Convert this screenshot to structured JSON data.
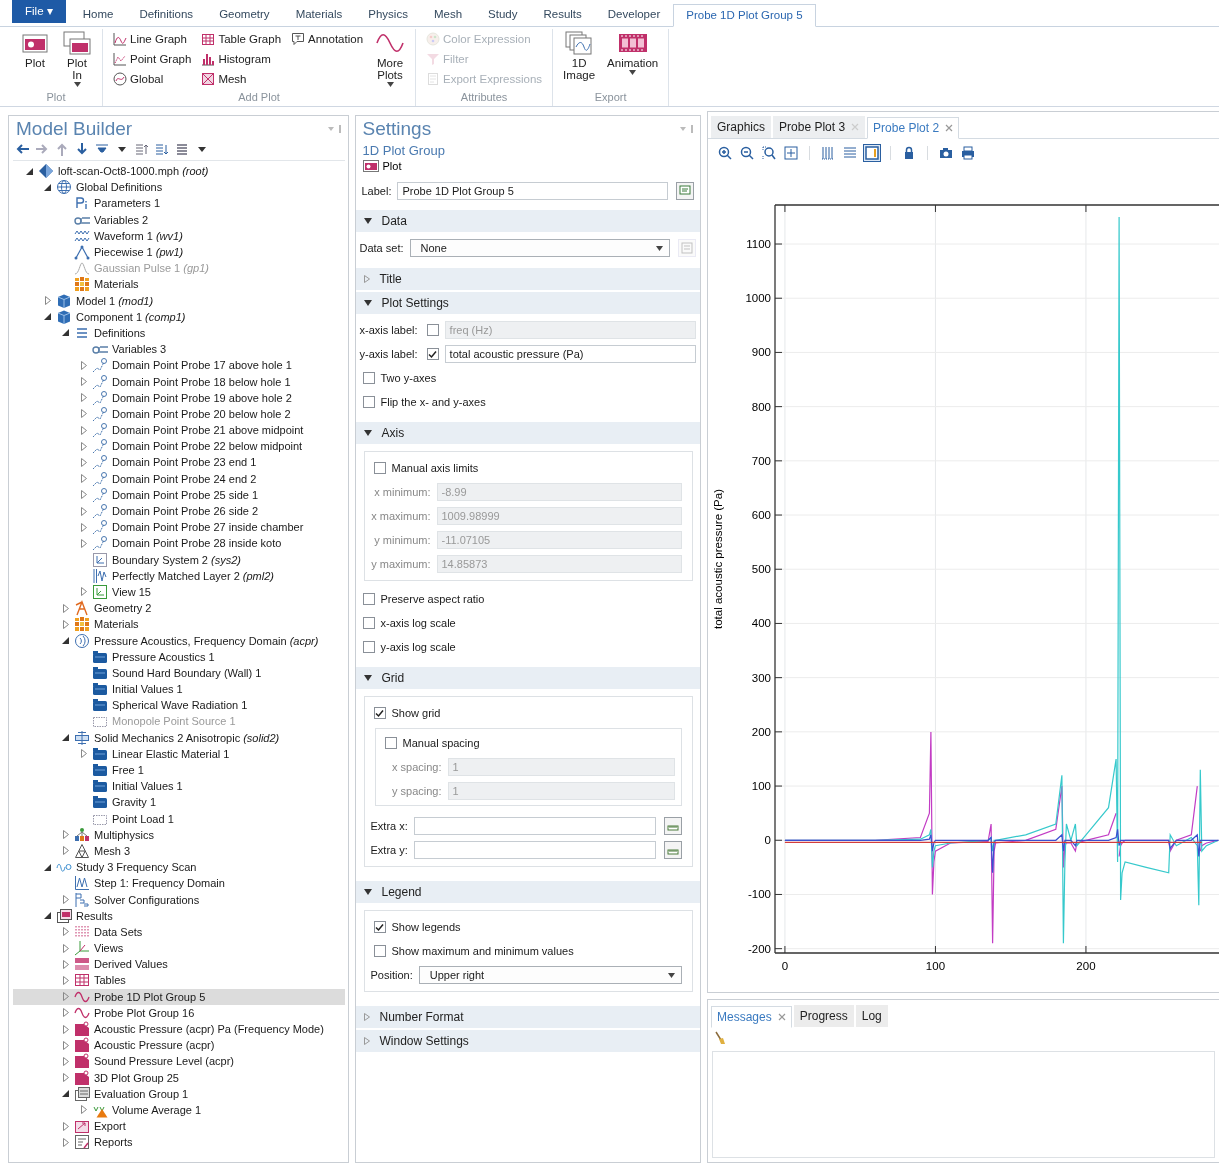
{
  "ribbon": {
    "tabs": [
      {
        "label": "File ▾",
        "kind": "file",
        "selected": false
      },
      {
        "label": "Home",
        "kind": "tab",
        "selected": false
      },
      {
        "label": "Definitions",
        "kind": "tab",
        "selected": false
      },
      {
        "label": "Geometry",
        "kind": "tab",
        "selected": false
      },
      {
        "label": "Materials",
        "kind": "tab",
        "selected": false
      },
      {
        "label": "Physics",
        "kind": "tab",
        "selected": false
      },
      {
        "label": "Mesh",
        "kind": "tab",
        "selected": false
      },
      {
        "label": "Study",
        "kind": "tab",
        "selected": false
      },
      {
        "label": "Results",
        "kind": "tab",
        "selected": false
      },
      {
        "label": "Developer",
        "kind": "tab",
        "selected": false
      },
      {
        "label": "Probe 1D Plot Group 5",
        "kind": "contextual",
        "selected": true
      }
    ],
    "groups": [
      {
        "title": "Plot",
        "buttons": [
          {
            "label": "Plot",
            "kind": "large",
            "dropdown": false,
            "disabled": false
          },
          {
            "label": "Plot In",
            "kind": "large",
            "dropdown": true,
            "disabled": false
          }
        ]
      },
      {
        "title": "Add Plot",
        "buttons": [
          {
            "label": "Line Graph",
            "kind": "small",
            "dropdown": false,
            "disabled": false
          },
          {
            "label": "Point Graph",
            "kind": "small",
            "dropdown": false,
            "disabled": false
          },
          {
            "label": "Global",
            "kind": "small",
            "dropdown": false,
            "disabled": false
          },
          {
            "label": "Table Graph",
            "kind": "small",
            "dropdown": false,
            "disabled": false
          },
          {
            "label": "Histogram",
            "kind": "small",
            "dropdown": false,
            "disabled": false
          },
          {
            "label": "Mesh",
            "kind": "small",
            "dropdown": false,
            "disabled": false
          },
          {
            "label": "Annotation",
            "kind": "small",
            "dropdown": false,
            "disabled": false
          },
          {
            "label": "More Plots",
            "kind": "large",
            "dropdown": true,
            "disabled": false
          }
        ]
      },
      {
        "title": "Attributes",
        "buttons": [
          {
            "label": "Color Expression",
            "kind": "small",
            "dropdown": false,
            "disabled": true
          },
          {
            "label": "Filter",
            "kind": "small",
            "dropdown": false,
            "disabled": true
          },
          {
            "label": "Export Expressions",
            "kind": "small",
            "dropdown": false,
            "disabled": true
          }
        ]
      },
      {
        "title": "Export",
        "buttons": [
          {
            "label": "1D Image",
            "kind": "large",
            "dropdown": false,
            "disabled": false
          },
          {
            "label": "Animation",
            "kind": "large",
            "dropdown": true,
            "disabled": false
          }
        ]
      }
    ]
  },
  "model_builder": {
    "title": "Model Builder",
    "tree": [
      {
        "label": "loft-scan-Oct8-1000.mph *(root)*",
        "kind": "root",
        "expanded": true,
        "selected": false,
        "disabled": false,
        "children": [
          {
            "label": "Global Definitions",
            "kind": "global",
            "expanded": true,
            "selected": false,
            "disabled": false,
            "children": [
              {
                "label": "Parameters 1",
                "kind": "param",
                "selected": false,
                "disabled": false
              },
              {
                "label": "Variables 2",
                "kind": "variables",
                "selected": false,
                "disabled": false
              },
              {
                "label": "Waveform 1 *(wv1)*",
                "kind": "waveform",
                "selected": false,
                "disabled": false
              },
              {
                "label": "Piecewise 1 *(pw1)*",
                "kind": "piecewise",
                "selected": false,
                "disabled": false
              },
              {
                "label": "Gaussian Pulse 1 *(gp1)*",
                "kind": "gaussian",
                "selected": false,
                "disabled": true
              },
              {
                "label": "Materials",
                "kind": "materials",
                "selected": false,
                "disabled": false
              }
            ]
          },
          {
            "label": "Model 1 *(mod1)*",
            "kind": "model",
            "expanded": false,
            "selected": false,
            "disabled": false
          },
          {
            "label": "Component 1 *(comp1)*",
            "kind": "model",
            "expanded": true,
            "selected": false,
            "disabled": false,
            "children": [
              {
                "label": "Definitions",
                "kind": "definitions",
                "expanded": true,
                "selected": false,
                "disabled": false,
                "children": [
                  {
                    "label": "Variables 3",
                    "kind": "variables",
                    "selected": false,
                    "disabled": false
                  },
                  {
                    "label": "Domain Point Probe 17 above hole 1",
                    "kind": "probe",
                    "expanded": false,
                    "selected": false,
                    "disabled": false
                  },
                  {
                    "label": "Domain Point Probe 18 below hole 1",
                    "kind": "probe",
                    "expanded": false,
                    "selected": false,
                    "disabled": false
                  },
                  {
                    "label": "Domain Point Probe 19 above hole 2",
                    "kind": "probe",
                    "expanded": false,
                    "selected": false,
                    "disabled": false
                  },
                  {
                    "label": "Domain Point Probe 20 below hole 2",
                    "kind": "probe",
                    "expanded": false,
                    "selected": false,
                    "disabled": false
                  },
                  {
                    "label": "Domain Point Probe 21 above midpoint",
                    "kind": "probe",
                    "expanded": false,
                    "selected": false,
                    "disabled": false
                  },
                  {
                    "label": "Domain Point Probe 22 below midpoint",
                    "kind": "probe",
                    "expanded": false,
                    "selected": false,
                    "disabled": false
                  },
                  {
                    "label": "Domain Point Probe 23 end 1",
                    "kind": "probe",
                    "expanded": false,
                    "selected": false,
                    "disabled": false
                  },
                  {
                    "label": "Domain Point Probe 24 end 2",
                    "kind": "probe",
                    "expanded": false,
                    "selected": false,
                    "disabled": false
                  },
                  {
                    "label": "Domain Point Probe 25 side 1",
                    "kind": "probe",
                    "expanded": false,
                    "selected": false,
                    "disabled": false
                  },
                  {
                    "label": "Domain Point Probe 26 side 2",
                    "kind": "probe",
                    "expanded": false,
                    "selected": false,
                    "disabled": false
                  },
                  {
                    "label": "Domain Point Probe 27 inside chamber",
                    "kind": "probe",
                    "expanded": false,
                    "selected": false,
                    "disabled": false
                  },
                  {
                    "label": "Domain Point Probe 28 inside koto",
                    "kind": "probe",
                    "expanded": false,
                    "selected": false,
                    "disabled": false
                  },
                  {
                    "label": "Boundary System 2 *(sys2)*",
                    "kind": "boundary",
                    "selected": false,
                    "disabled": false
                  },
                  {
                    "label": "Perfectly Matched Layer 2 *(pml2)*",
                    "kind": "pml",
                    "selected": false,
                    "disabled": false
                  },
                  {
                    "label": "View 15",
                    "kind": "view",
                    "expanded": false,
                    "selected": false,
                    "disabled": false
                  }
                ]
              },
              {
                "label": "Geometry 2",
                "kind": "geometry",
                "expanded": false,
                "selected": false,
                "disabled": false
              },
              {
                "label": "Materials",
                "kind": "materials",
                "expanded": false,
                "selected": false,
                "disabled": false
              },
              {
                "label": "Pressure Acoustics, Frequency Domain *(acpr)*",
                "kind": "acoustics",
                "expanded": true,
                "selected": false,
                "disabled": false,
                "children": [
                  {
                    "label": "Pressure Acoustics 1",
                    "kind": "feature",
                    "selected": false,
                    "disabled": false
                  },
                  {
                    "label": "Sound Hard Boundary (Wall) 1",
                    "kind": "feature",
                    "selected": false,
                    "disabled": false
                  },
                  {
                    "label": "Initial Values 1",
                    "kind": "feature",
                    "selected": false,
                    "disabled": false
                  },
                  {
                    "label": "Spherical Wave Radiation 1",
                    "kind": "feature",
                    "selected": false,
                    "disabled": false
                  },
                  {
                    "label": "Monopole Point Source 1",
                    "kind": "point",
                    "selected": false,
                    "disabled": true
                  }
                ]
              },
              {
                "label": "Solid Mechanics 2 Anisotropic *(solid2)*",
                "kind": "solid",
                "expanded": true,
                "selected": false,
                "disabled": false,
                "children": [
                  {
                    "label": "Linear Elastic Material 1",
                    "kind": "feature",
                    "expanded": false,
                    "selected": false,
                    "disabled": false
                  },
                  {
                    "label": "Free 1",
                    "kind": "feature",
                    "selected": false,
                    "disabled": false
                  },
                  {
                    "label": "Initial Values 1",
                    "kind": "feature",
                    "selected": false,
                    "disabled": false
                  },
                  {
                    "label": "Gravity 1",
                    "kind": "feature",
                    "selected": false,
                    "disabled": false
                  },
                  {
                    "label": "Point Load 1",
                    "kind": "point",
                    "selected": false,
                    "disabled": false
                  }
                ]
              },
              {
                "label": "Multiphysics",
                "kind": "multiphysics",
                "expanded": false,
                "selected": false,
                "disabled": false
              },
              {
                "label": "Mesh 3",
                "kind": "mesh",
                "expanded": false,
                "selected": false,
                "disabled": false
              }
            ]
          },
          {
            "label": "Study 3 Frequency Scan",
            "kind": "study",
            "expanded": true,
            "selected": false,
            "disabled": false,
            "children": [
              {
                "label": "Step 1: Frequency Domain",
                "kind": "step",
                "selected": false,
                "disabled": false
              },
              {
                "label": "Solver Configurations",
                "kind": "solver",
                "expanded": false,
                "selected": false,
                "disabled": false
              }
            ]
          },
          {
            "label": "Results",
            "kind": "results",
            "expanded": true,
            "selected": false,
            "disabled": false,
            "children": [
              {
                "label": "Data Sets",
                "kind": "datasets",
                "expanded": false,
                "selected": false,
                "disabled": false
              },
              {
                "label": "Views",
                "kind": "views",
                "expanded": false,
                "selected": false,
                "disabled": false
              },
              {
                "label": "Derived Values",
                "kind": "derived",
                "expanded": false,
                "selected": false,
                "disabled": false
              },
              {
                "label": "Tables",
                "kind": "tables",
                "expanded": false,
                "selected": false,
                "disabled": false
              },
              {
                "label": "Probe 1D Plot Group 5",
                "kind": "plot1d",
                "expanded": false,
                "selected": true,
                "disabled": false
              },
              {
                "label": "Probe Plot Group 16",
                "kind": "plot1d",
                "expanded": false,
                "selected": false,
                "disabled": false
              },
              {
                "label": "Acoustic Pressure (acpr) Pa (Frequency Mode)",
                "kind": "plot3d",
                "expanded": false,
                "selected": false,
                "disabled": false
              },
              {
                "label": "Acoustic Pressure (acpr)",
                "kind": "plot3d",
                "expanded": false,
                "selected": false,
                "disabled": false
              },
              {
                "label": "Sound Pressure Level (acpr)",
                "kind": "plot3d",
                "expanded": false,
                "selected": false,
                "disabled": false
              },
              {
                "label": "3D Plot Group 25",
                "kind": "plot3d",
                "expanded": false,
                "selected": false,
                "disabled": false
              },
              {
                "label": "Evaluation Group 1",
                "kind": "evalgroup",
                "expanded": true,
                "selected": false,
                "disabled": false,
                "children": [
                  {
                    "label": "Volume Average 1",
                    "kind": "volavg",
                    "expanded": false,
                    "selected": false,
                    "disabled": false
                  }
                ]
              },
              {
                "label": "Export",
                "kind": "export",
                "expanded": false,
                "selected": false,
                "disabled": false
              },
              {
                "label": "Reports",
                "kind": "reports",
                "expanded": false,
                "selected": false,
                "disabled": false
              }
            ]
          }
        ]
      }
    ]
  },
  "settings": {
    "title": "Settings",
    "subtitle": "1D Plot Group",
    "plot_button": "Plot",
    "label_field": {
      "label": "Label:",
      "value": "Probe 1D Plot Group 5"
    },
    "sections": [
      {
        "title": "Data",
        "expanded": true,
        "rows": [
          {
            "kind": "select-button",
            "label": "Data set:",
            "value": "None",
            "disabled": true
          }
        ]
      },
      {
        "title": "Title",
        "expanded": false
      },
      {
        "title": "Plot Settings",
        "expanded": true,
        "rows": [
          {
            "kind": "check-field",
            "label": "x-axis label:",
            "checked": false,
            "value": "freq (Hz)",
            "disabled": true
          },
          {
            "kind": "check-field",
            "label": "y-axis label:",
            "checked": true,
            "value": "total acoustic pressure (Pa)",
            "disabled": false
          },
          {
            "kind": "check",
            "label": "Two y-axes",
            "checked": false
          },
          {
            "kind": "check",
            "label": "Flip the x- and y-axes",
            "checked": false
          }
        ]
      },
      {
        "title": "Axis",
        "expanded": true,
        "rows": [
          {
            "kind": "group",
            "rows": [
              {
                "kind": "check",
                "label": "Manual axis limits",
                "checked": false
              },
              {
                "kind": "field",
                "label": "x minimum:",
                "value": "-8.99",
                "disabled": true
              },
              {
                "kind": "field",
                "label": "x maximum:",
                "value": "1009.98999",
                "disabled": true
              },
              {
                "kind": "field",
                "label": "y minimum:",
                "value": "-11.07105",
                "disabled": true
              },
              {
                "kind": "field",
                "label": "y maximum:",
                "value": "14.85873",
                "disabled": true
              }
            ]
          },
          {
            "kind": "check",
            "label": "Preserve aspect ratio",
            "checked": false
          },
          {
            "kind": "check",
            "label": "x-axis log scale",
            "checked": false
          },
          {
            "kind": "check",
            "label": "y-axis log scale",
            "checked": false
          }
        ]
      },
      {
        "title": "Grid",
        "expanded": true,
        "rows": [
          {
            "kind": "group",
            "rows": [
              {
                "kind": "check",
                "label": "Show grid",
                "checked": true
              },
              {
                "kind": "group",
                "rows": [
                  {
                    "kind": "check",
                    "label": "Manual spacing",
                    "checked": false
                  },
                  {
                    "kind": "field",
                    "label": "x spacing:",
                    "value": "1",
                    "disabled": true
                  },
                  {
                    "kind": "field",
                    "label": "y spacing:",
                    "value": "1",
                    "disabled": true
                  }
                ]
              },
              {
                "kind": "field-button",
                "label": "Extra x:",
                "disabled": false
              },
              {
                "kind": "field-button",
                "label": "Extra y:",
                "disabled": false
              }
            ]
          }
        ]
      },
      {
        "title": "Legend",
        "expanded": true,
        "rows": [
          {
            "kind": "group",
            "rows": [
              {
                "kind": "check",
                "label": "Show legends",
                "checked": true
              },
              {
                "kind": "check",
                "label": "Show maximum and minimum values",
                "checked": false
              },
              {
                "kind": "select",
                "label": "Position:",
                "value": "Upper right",
                "disabled": false
              }
            ]
          }
        ]
      },
      {
        "title": "Number Format",
        "expanded": false
      },
      {
        "title": "Window Settings",
        "expanded": false
      }
    ]
  },
  "graphics": {
    "tabs": [
      {
        "label": "Graphics",
        "closable": false,
        "selected": false
      },
      {
        "label": "Probe Plot 3",
        "closable": true,
        "selected": false
      },
      {
        "label": "Probe Plot 2",
        "closable": true,
        "selected": true
      }
    ],
    "toolbar": [
      {
        "on": false
      },
      {
        "on": false
      },
      {
        "on": false
      },
      {
        "on": false
      },
      {
        "on": false
      },
      {
        "on": false
      },
      {
        "on": true
      },
      {
        "on": false
      },
      {
        "on": false
      },
      {
        "on": false
      }
    ],
    "chart_data": {
      "type": "line",
      "grid": true,
      "ylabel": "total acoustic pressure (Pa)",
      "xlim": [
        -6.6,
        288.4
      ],
      "ylim": [
        -208,
        1172
      ],
      "xticks": [
        0,
        100,
        200
      ],
      "yticks": [
        -200,
        -100,
        0,
        100,
        200,
        300,
        400,
        500,
        600,
        700,
        800,
        900,
        1000,
        1100
      ],
      "x": [
        0,
        60,
        90,
        96,
        97,
        98,
        99,
        100,
        110,
        135,
        137,
        138,
        139,
        140,
        160,
        180,
        184,
        185,
        186,
        187,
        190,
        193,
        194,
        200,
        215,
        220,
        221,
        222,
        223,
        224,
        226,
        240,
        255,
        256,
        260,
        270,
        274,
        275,
        276,
        277,
        280,
        288
      ],
      "series": [
        {
          "color": "#c23cc4",
          "values": [
            0,
            0,
            5,
            50,
            200,
            -100,
            -40,
            -20,
            -5,
            -2,
            30,
            -190,
            -20,
            -5,
            0,
            20,
            100,
            -50,
            -10,
            -5,
            -5,
            -20,
            -5,
            0,
            10,
            50,
            null,
            -30,
            -10,
            -5,
            0,
            0,
            0,
            -20,
            0,
            10,
            100,
            null,
            -20,
            -10,
            -5,
            0
          ]
        },
        {
          "color": "#36c9cc",
          "values": [
            0,
            0,
            2,
            10,
            20,
            -50,
            -20,
            -10,
            -5,
            0,
            5,
            -20,
            0,
            0,
            10,
            30,
            120,
            -190,
            -40,
            30,
            0,
            30,
            -10,
            10,
            60,
            150,
            -40,
            1150,
            -110,
            -60,
            -40,
            -50,
            -60,
            10,
            -10,
            5,
            -10,
            -120,
            130,
            -20,
            -10,
            0
          ]
        },
        {
          "color": "#3a4fd0",
          "values": [
            0,
            0,
            0,
            2,
            10,
            -20,
            -5,
            0,
            0,
            0,
            5,
            -60,
            -5,
            0,
            0,
            0,
            10,
            -20,
            0,
            0,
            0,
            -10,
            0,
            0,
            0,
            5,
            20,
            -10,
            0,
            0,
            0,
            0,
            0,
            -15,
            0,
            0,
            10,
            -30,
            0,
            0,
            0,
            0
          ]
        },
        {
          "color": "#d23c3c",
          "values": [
            -4,
            -4,
            -4,
            -4,
            -4,
            -4,
            -4,
            -4,
            -4,
            -4,
            -4,
            -4,
            -4,
            -4,
            -4,
            -4,
            -4,
            -4,
            -4,
            -4,
            -4,
            -4,
            -4,
            -4,
            -4,
            -4,
            -4,
            -4,
            -4,
            -4,
            -4,
            -4,
            -4,
            -4,
            -4,
            -4,
            -4,
            -4,
            -4,
            -4,
            null,
            null
          ]
        }
      ]
    }
  },
  "messages": {
    "tabs": [
      {
        "label": "Messages",
        "closable": true,
        "selected": true
      },
      {
        "label": "Progress",
        "closable": false,
        "selected": false
      },
      {
        "label": "Log",
        "closable": false,
        "selected": false
      }
    ]
  }
}
